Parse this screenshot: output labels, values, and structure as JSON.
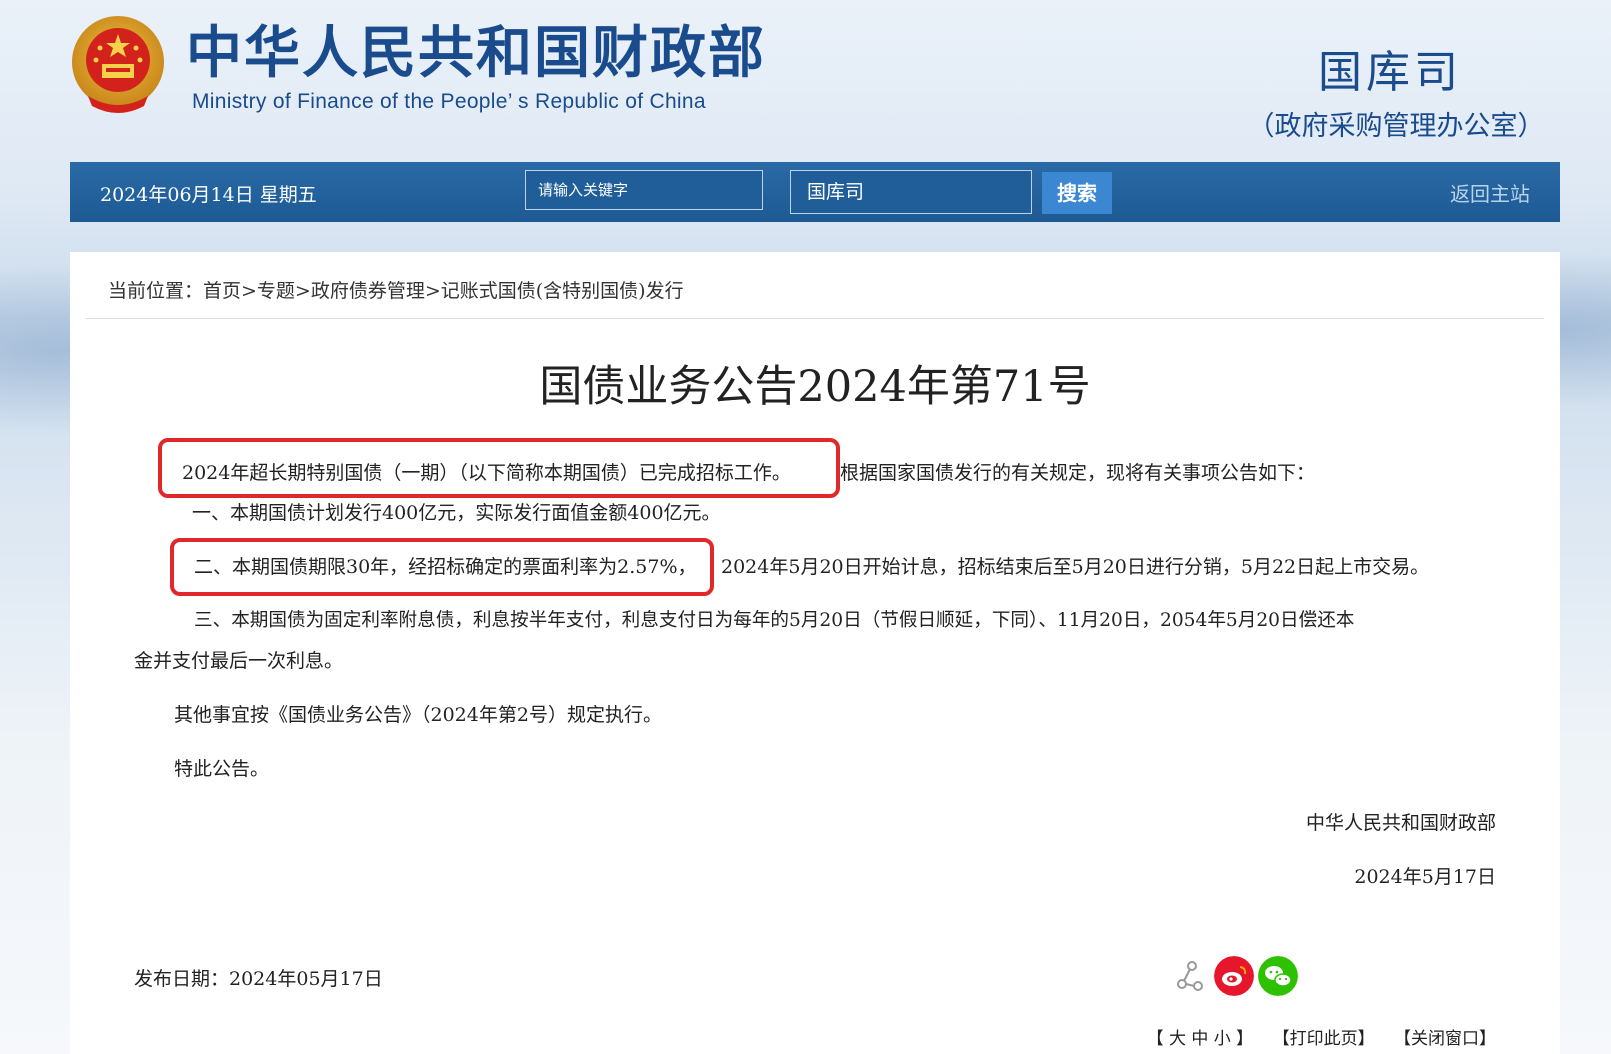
{
  "header": {
    "title_cn": "中华人民共和国财政部",
    "title_en": "Ministry of Finance of the People’ s Republic of China",
    "dept_name": "国库司",
    "dept_sub": "（政府采购管理办公室）"
  },
  "navbar": {
    "date": "2024年06月14日  星期五",
    "search_placeholder": "请输入关键字",
    "scope_value": "国库司",
    "search_label": "搜索",
    "return_label": "返回主站"
  },
  "breadcrumb": "当前位置：首页>专题>政府债券管理>记账式国债(含特别国债)发行",
  "article": {
    "title": "国债业务公告2024年第71号",
    "intro_highlight": "2024年超长期特别国债（一期）（以下简称本期国债）已完成招标工作。",
    "intro_rest": "根据国家国债发行的有关规定，现将有关事项公告如下：",
    "item1": "一、本期国债计划发行400亿元，实际发行面值金额400亿元。",
    "item2_highlight": "二、本期国债期限30年，经招标确定的票面利率为2.57%，",
    "item2_rest": "2024年5月20日开始计息，招标结束后至5月20日进行分销，5月22日起上市交易。",
    "item3_line1": "三、本期国债为固定利率附息债，利息按半年支付，利息支付日为每年的5月20日（节假日顺延，下同）、11月20日，2054年5月20日偿还本",
    "item3_line2": "金并支付最后一次利息。",
    "other": "其他事宜按《国债业务公告》（2024年第2号）规定执行。",
    "closing": "特此公告。",
    "signature": "中华人民共和国财政部",
    "sign_date": "2024年5月17日",
    "publish_date": "发布日期：2024年05月17日"
  },
  "tools": {
    "font_size": "【 大 中 小 】",
    "print": "【打印此页】",
    "close": "【关闭窗口】"
  },
  "colors": {
    "brand_blue": "#1a4b8c",
    "navbar": "#1d5a94",
    "highlight_red": "#e0282a",
    "weibo_red": "#e6162d",
    "wechat_green": "#2dc100"
  }
}
